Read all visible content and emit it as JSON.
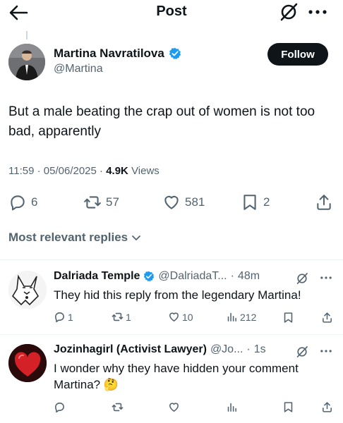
{
  "header": {
    "title": "Post"
  },
  "post": {
    "author_name": "Martina Navratilova",
    "author_handle": "@Martina",
    "follow_label": "Follow",
    "text": "But a male beating the crap out of women is not too bad, apparently",
    "time": "11:59",
    "date": "05/06/2025",
    "views_count": "4.9K",
    "views_label": "Views",
    "replies": "6",
    "reposts": "57",
    "likes": "581",
    "bookmarks": "2"
  },
  "replies_section": {
    "label": "Most relevant replies"
  },
  "replies": [
    {
      "name": "Dalriada Temple",
      "handle": "@DalriadaT...",
      "time": "48m",
      "text": "They hid this reply from the legendary Martina!",
      "reply_count": "1",
      "repost_count": "1",
      "like_count": "10",
      "view_count": "212"
    },
    {
      "name": "Jozinhagirl (Activist Lawyer)",
      "handle": "@Jo...",
      "time": "1s",
      "text": "I wonder why they have hidden your comment Martina? 🤔"
    }
  ],
  "colors": {
    "verified": "#1d9bf0",
    "text": "#0f1419",
    "secondary": "#536471",
    "follow_bg": "#0f1419"
  },
  "icons": [
    "back-arrow-icon",
    "grok-icon",
    "more-icon",
    "verified-icon",
    "reply-icon",
    "repost-icon",
    "like-icon",
    "bookmark-icon",
    "share-icon",
    "views-icon",
    "chevron-down-icon"
  ]
}
